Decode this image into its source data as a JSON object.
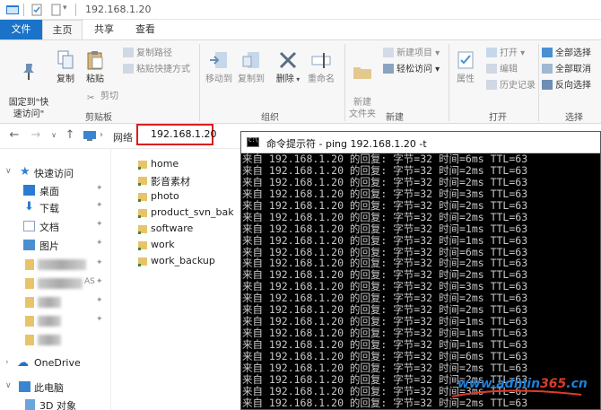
{
  "window": {
    "title": "192.168.1.20"
  },
  "tabs": {
    "file": "文件",
    "home": "主页",
    "share": "共享",
    "view": "查看"
  },
  "ribbon": {
    "pin_quick_access": "固定到\"快\n速访问\"",
    "copy": "复制",
    "paste": "粘贴",
    "copy_path": "复制路径",
    "paste_shortcut": "粘贴快捷方式",
    "cut": "剪切",
    "clipboard_group": "剪贴板",
    "move_to": "移动到",
    "copy_to": "复制到",
    "delete": "删除",
    "rename": "重命名",
    "organize_group": "组织",
    "new_folder": "新建\n文件夹",
    "new_item": "新建项目",
    "easy_access": "轻松访问",
    "new_group": "新建",
    "properties": "属性",
    "open": "打开",
    "edit": "编辑",
    "history": "历史记录",
    "open_group": "打开",
    "select_all": "全部选择",
    "select_none": "全部取消",
    "invert_selection": "反向选择",
    "select_group": "选择"
  },
  "address": {
    "network": "网络",
    "ip": "192.168.1.20"
  },
  "nav": {
    "quick_access": "快速访问",
    "desktop": "桌面",
    "downloads": "下载",
    "documents": "文档",
    "pictures": "图片",
    "blurred_suffix": "AS",
    "onedrive": "OneDrive",
    "this_pc": "此电脑",
    "objects_3d": "3D 对象"
  },
  "files": [
    "home",
    "影音素材",
    "photo",
    "product_svn_bak",
    "software",
    "work",
    "work_backup"
  ],
  "cmd": {
    "title": "命令提示符 - ping  192.168.1.20 -t",
    "lines": [
      "来自 192.168.1.20 的回复: 字节=32 时间=6ms TTL=63",
      "来自 192.168.1.20 的回复: 字节=32 时间=2ms TTL=63",
      "来自 192.168.1.20 的回复: 字节=32 时间=2ms TTL=63",
      "来自 192.168.1.20 的回复: 字节=32 时间=3ms TTL=63",
      "来自 192.168.1.20 的回复: 字节=32 时间=2ms TTL=63",
      "来自 192.168.1.20 的回复: 字节=32 时间=2ms TTL=63",
      "来自 192.168.1.20 的回复: 字节=32 时间=1ms TTL=63",
      "来自 192.168.1.20 的回复: 字节=32 时间=1ms TTL=63",
      "来自 192.168.1.20 的回复: 字节=32 时间=6ms TTL=63",
      "来自 192.168.1.20 的回复: 字节=32 时间=2ms TTL=63",
      "来自 192.168.1.20 的回复: 字节=32 时间=2ms TTL=63",
      "来自 192.168.1.20 的回复: 字节=32 时间=3ms TTL=63",
      "来自 192.168.1.20 的回复: 字节=32 时间=2ms TTL=63",
      "来自 192.168.1.20 的回复: 字节=32 时间=2ms TTL=63",
      "来自 192.168.1.20 的回复: 字节=32 时间=1ms TTL=63",
      "来自 192.168.1.20 的回复: 字节=32 时间=1ms TTL=63",
      "来自 192.168.1.20 的回复: 字节=32 时间=1ms TTL=63",
      "来自 192.168.1.20 的回复: 字节=32 时间=6ms TTL=63",
      "来自 192.168.1.20 的回复: 字节=32 时间=2ms TTL=63",
      "来自 192.168.1.20 的回复: 字节=32 时间=2ms TTL=63",
      "来自 192.168.1.20 的回复: 字节=32 时间=3ms TTL=63",
      "来自 192.168.1.20 的回复: 字节=32 时间=2ms TTL=63"
    ]
  },
  "watermark": {
    "prefix": "www.",
    "brand": "admin",
    "num": "365",
    "suffix": ".cn"
  }
}
